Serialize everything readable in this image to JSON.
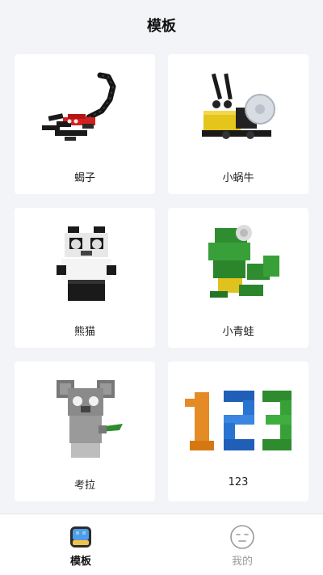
{
  "header": {
    "title": "模板"
  },
  "templates": [
    {
      "label": "蝎子",
      "icon": "scorpion-model-icon"
    },
    {
      "label": "小蜗牛",
      "icon": "snail-model-icon"
    },
    {
      "label": "熊猫",
      "icon": "panda-model-icon"
    },
    {
      "label": "小青蛙",
      "icon": "frog-model-icon"
    },
    {
      "label": "考拉",
      "icon": "koala-model-icon"
    },
    {
      "label": "123",
      "icon": "number-123-model-icon"
    }
  ],
  "tabbar": {
    "tabs": [
      {
        "label": "模板",
        "icon": "template-tab-icon",
        "active": true,
        "color": "#111111"
      },
      {
        "label": "我的",
        "icon": "profile-face-icon",
        "active": false,
        "color": "#9a9a9a"
      }
    ]
  }
}
